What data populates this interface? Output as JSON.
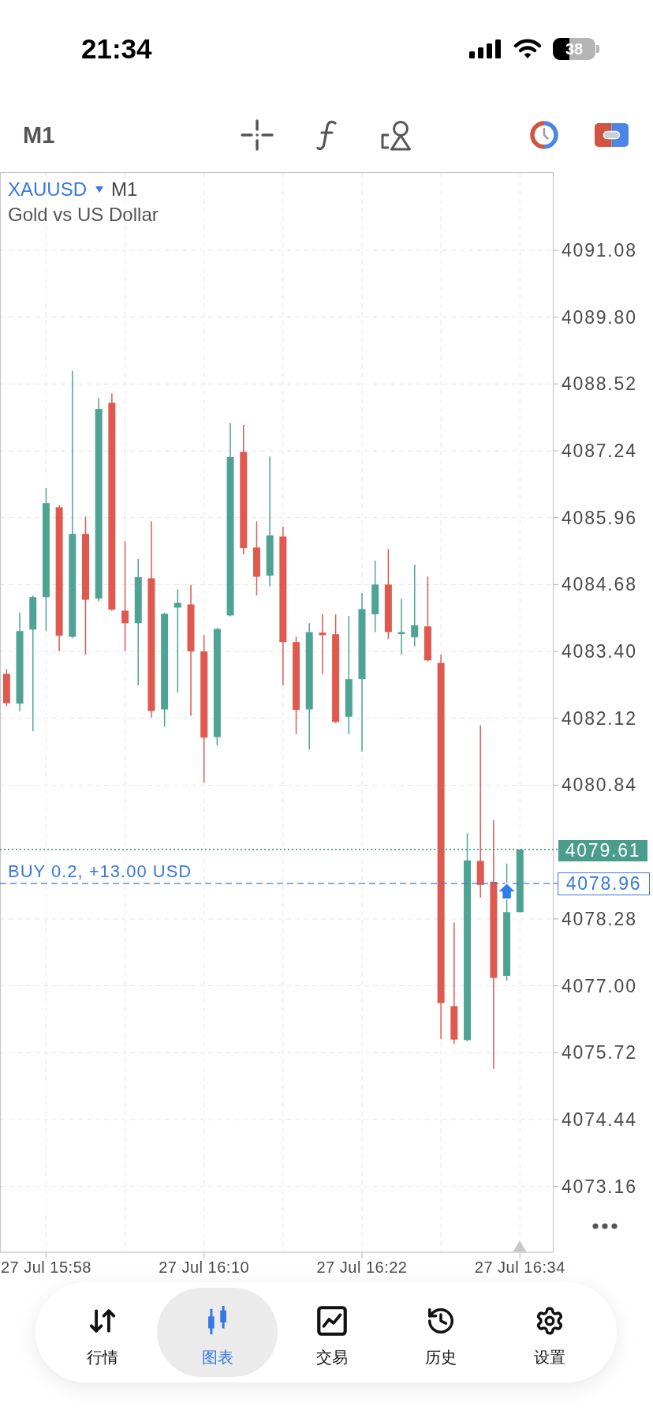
{
  "status_bar": {
    "time": "21:34",
    "battery": "38"
  },
  "toolbar": {
    "timeframe": "M1"
  },
  "chart": {
    "symbol": "XAUUSD",
    "timeframe": "M1",
    "description": "Gold vs US Dollar",
    "chart_data": {
      "type": "candlestick",
      "grid": true,
      "categories": [
        null,
        null,
        null,
        "27 Jul 15:58",
        null,
        null,
        null,
        null,
        null,
        null,
        null,
        null,
        null,
        null,
        null,
        "27 Jul 16:10",
        null,
        null,
        null,
        null,
        null,
        null,
        null,
        null,
        null,
        null,
        null,
        "27 Jul 16:22",
        null,
        null,
        null,
        null,
        null,
        null,
        null,
        null,
        null,
        null,
        null,
        "27 Jul 16:34",
        null,
        null
      ],
      "ohlc": [
        [
          4082.97,
          4083.06,
          4082.35,
          4082.41
        ],
        [
          4082.4,
          4084.14,
          4082.26,
          4083.79
        ],
        [
          4083.82,
          4084.47,
          4081.87,
          4084.44
        ],
        [
          4084.44,
          4086.53,
          4083.79,
          4086.24
        ],
        [
          4086.16,
          4086.2,
          4083.4,
          4083.7
        ],
        [
          4083.68,
          4088.77,
          4083.65,
          4085.65
        ],
        [
          4085.65,
          4085.98,
          4083.34,
          4084.39
        ],
        [
          4084.41,
          4088.25,
          4084.36,
          4088.04
        ],
        [
          4088.16,
          4088.34,
          4084.18,
          4084.2
        ],
        [
          4084.18,
          4085.51,
          4083.41,
          4083.94
        ],
        [
          4083.94,
          4085.17,
          4082.75,
          4084.82
        ],
        [
          4084.8,
          4085.89,
          4082.14,
          4082.26
        ],
        [
          4082.29,
          4084.14,
          4081.96,
          4084.12
        ],
        [
          4084.24,
          4084.59,
          4082.61,
          4084.33
        ],
        [
          4084.3,
          4084.67,
          4082.17,
          4083.4
        ],
        [
          4083.4,
          4083.71,
          4080.89,
          4081.75
        ],
        [
          4081.76,
          4083.85,
          4081.6,
          4083.83
        ],
        [
          4084.09,
          4087.77,
          4084.07,
          4087.12
        ],
        [
          4087.22,
          4087.74,
          4085.26,
          4085.38
        ],
        [
          4085.39,
          4085.89,
          4084.47,
          4084.83
        ],
        [
          4084.85,
          4087.13,
          4084.65,
          4085.62
        ],
        [
          4085.6,
          4085.79,
          4082.75,
          4083.58
        ],
        [
          4083.58,
          4083.68,
          4081.82,
          4082.28
        ],
        [
          4082.29,
          4083.94,
          4081.52,
          4083.77
        ],
        [
          4083.76,
          4084.12,
          4082.97,
          4083.71
        ],
        [
          4083.73,
          4084.11,
          4082.03,
          4082.05
        ],
        [
          4082.15,
          4084.08,
          4081.82,
          4082.87
        ],
        [
          4082.87,
          4084.52,
          4081.48,
          4084.21
        ],
        [
          4084.11,
          4085.14,
          4083.77,
          4084.68
        ],
        [
          4084.68,
          4085.36,
          4083.64,
          4083.77
        ],
        [
          4083.74,
          4084.41,
          4083.34,
          4083.77
        ],
        [
          4083.67,
          4085.06,
          4083.5,
          4083.9
        ],
        [
          4083.88,
          4084.83,
          4083.21,
          4083.23
        ],
        [
          4083.18,
          4083.34,
          4075.98,
          4076.67
        ],
        [
          4076.61,
          4078.21,
          4075.89,
          4075.97
        ],
        [
          4075.96,
          4079.92,
          4075.94,
          4079.4
        ],
        [
          4079.39,
          4081.99,
          4078.69,
          4078.93
        ],
        [
          4078.99,
          4080.17,
          4075.41,
          4077.15
        ],
        [
          4077.19,
          4079.34,
          4077.1,
          4078.41
        ],
        [
          4078.41,
          4079.61,
          4078.41,
          4079.61
        ],
        null,
        null
      ],
      "ylim": [
        4071.9,
        4092.56
      ],
      "yticks": [
        {
          "value": 4091.08,
          "label": "4091.08"
        },
        {
          "value": 4089.8,
          "label": "4089.80"
        },
        {
          "value": 4088.52,
          "label": "4088.52"
        },
        {
          "value": 4087.24,
          "label": "4087.24"
        },
        {
          "value": 4085.96,
          "label": "4085.96"
        },
        {
          "value": 4084.68,
          "label": "4084.68"
        },
        {
          "value": 4083.4,
          "label": "4083.40"
        },
        {
          "value": 4082.12,
          "label": "4082.12"
        },
        {
          "value": 4080.84,
          "label": "4080.84"
        },
        {
          "value": 4078.28,
          "label": "4078.28"
        },
        {
          "value": 4077,
          "label": "4077.00"
        },
        {
          "value": 4075.72,
          "label": "4075.72"
        },
        {
          "value": 4074.44,
          "label": "4074.44"
        },
        {
          "value": 4073.16,
          "label": "4073.16"
        }
      ],
      "ref_lines": [
        {
          "axis": "y",
          "value": 4079.61,
          "label": "4079.61",
          "color": "#4a9c8c"
        },
        {
          "axis": "y",
          "value": 4078.96,
          "label": "4078.96",
          "color": "#3a78dc"
        }
      ],
      "annotations": [
        "BUY 0.2, +13.00 USD"
      ]
    }
  },
  "tabs": [
    {
      "label": "行情",
      "selected": false
    },
    {
      "label": "图表",
      "selected": true
    },
    {
      "label": "交易",
      "selected": false
    },
    {
      "label": "历史",
      "selected": false
    },
    {
      "label": "设置",
      "selected": false
    }
  ]
}
